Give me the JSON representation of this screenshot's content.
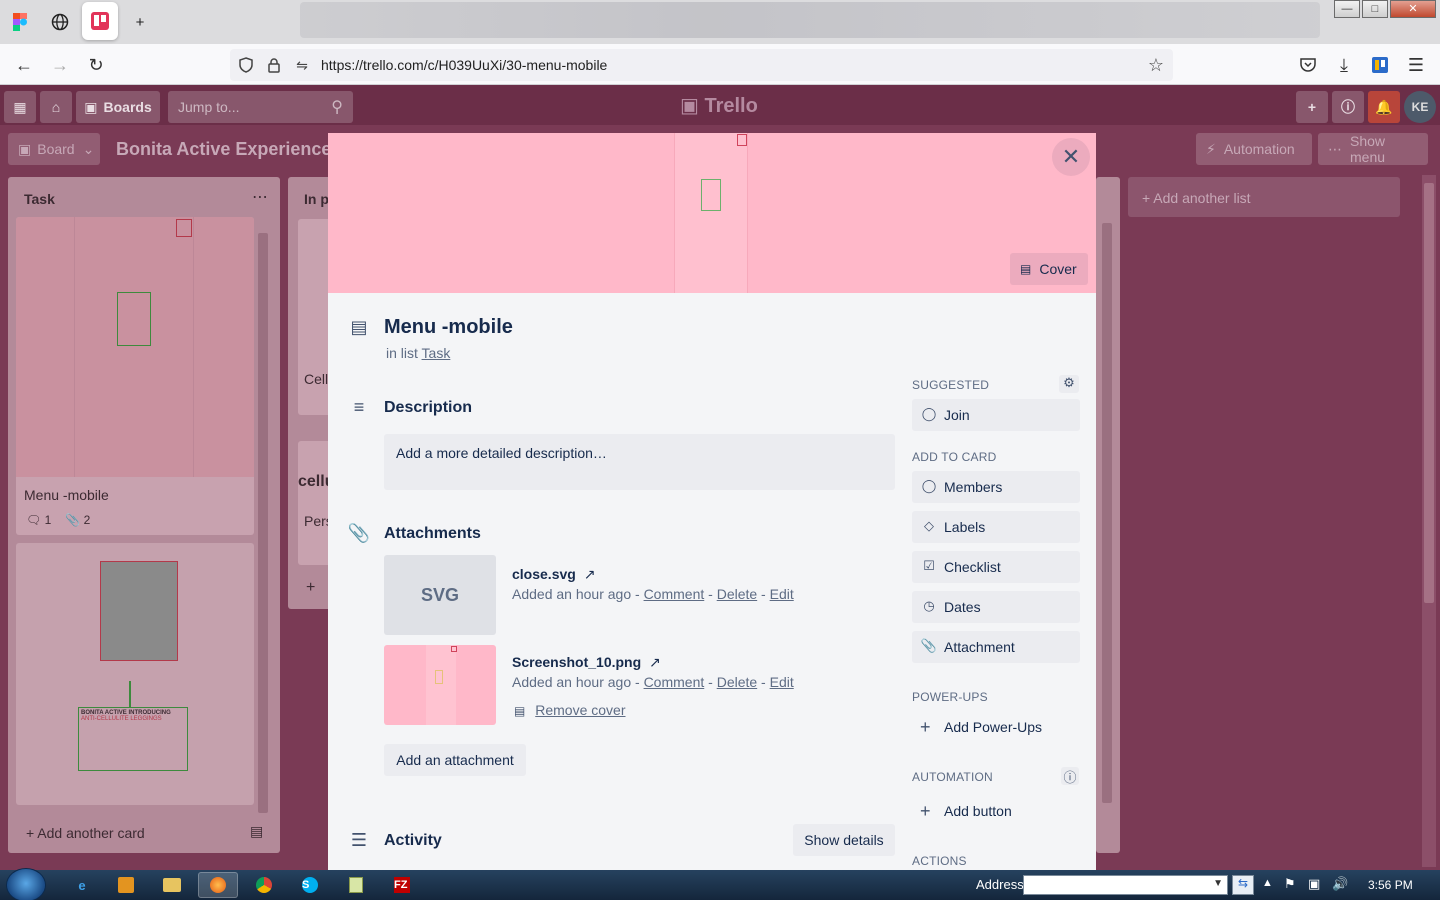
{
  "browser": {
    "url": "https://trello.com/c/H039UuXi/30-menu-mobile"
  },
  "trello": {
    "boards_label": "Boards",
    "search_placeholder": "Jump to...",
    "logo": "Trello",
    "avatar": "KE",
    "board_view_label": "Board",
    "board_title": "Bonita Active Experience",
    "automation_label": "Automation",
    "show_menu_label": "Show menu",
    "add_list_label": "+ Add another list"
  },
  "lists": [
    {
      "title": "Task",
      "card_title": "Menu -mobile",
      "comments": "1",
      "attachments": "2",
      "add_card": "+ Add another card",
      "card2_heading": "BONITA ACTIVE INTRODUCING",
      "card2_subheading": "ANTI-CELLULITE LEGGINGS"
    },
    {
      "title": "In p",
      "card1_label": "Cell",
      "card2_text": "cellu",
      "card2_label": "Pers",
      "add_card": "+"
    }
  ],
  "modal": {
    "cover_label": "Cover",
    "card_title": "Menu -mobile",
    "in_list_prefix": "in list",
    "list_name": "Task",
    "description_title": "Description",
    "description_placeholder": "Add a more detailed description…",
    "attachments_title": "Attachments",
    "attachments": [
      {
        "thumb_text": "SVG",
        "name": "close.svg",
        "added": "Added an hour ago",
        "comment": "Comment",
        "delete": "Delete",
        "edit": "Edit"
      },
      {
        "name": "Screenshot_10.png",
        "added": "Added an hour ago",
        "comment": "Comment",
        "delete": "Delete",
        "edit": "Edit",
        "remove_cover": "Remove cover"
      }
    ],
    "add_attachment": "Add an attachment",
    "activity_title": "Activity",
    "show_details": "Show details",
    "sidebar": {
      "suggested": "SUGGESTED",
      "join": "Join",
      "add_to_card": "ADD TO CARD",
      "members": "Members",
      "labels": "Labels",
      "checklist": "Checklist",
      "dates": "Dates",
      "attachment": "Attachment",
      "power_ups": "POWER-UPS",
      "add_power_ups": "Add Power-Ups",
      "automation": "AUTOMATION",
      "add_button": "Add button",
      "actions": "ACTIONS"
    }
  },
  "taskbar": {
    "address_label": "Address",
    "clock": "3:56 PM"
  }
}
